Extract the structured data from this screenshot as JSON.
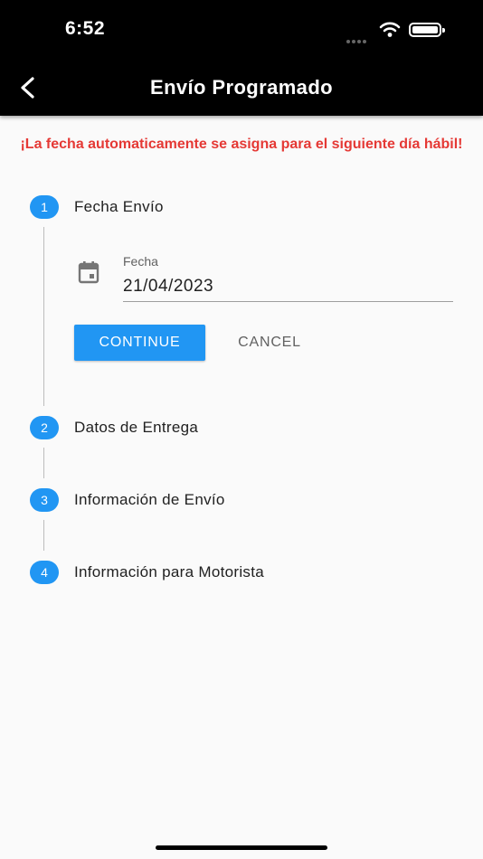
{
  "status_bar": {
    "time": "6:52"
  },
  "app_bar": {
    "title": "Envío Programado",
    "back_icon": "chevron-left-icon"
  },
  "warning": "¡La fecha automaticamente se asigna para el siguiente día hábil!",
  "steps": [
    {
      "number": "1",
      "title": "Fecha Envío",
      "active": true
    },
    {
      "number": "2",
      "title": "Datos de Entrega"
    },
    {
      "number": "3",
      "title": "Información de Envío"
    },
    {
      "number": "4",
      "title": "Información para Motorista"
    }
  ],
  "date_field": {
    "label": "Fecha",
    "value": "21/04/2023",
    "icon": "calendar-icon"
  },
  "buttons": {
    "continue": "CONTINUE",
    "cancel": "CANCEL"
  },
  "colors": {
    "accent": "#2196f3",
    "warning": "#e53935",
    "app_bar": "#000000"
  }
}
